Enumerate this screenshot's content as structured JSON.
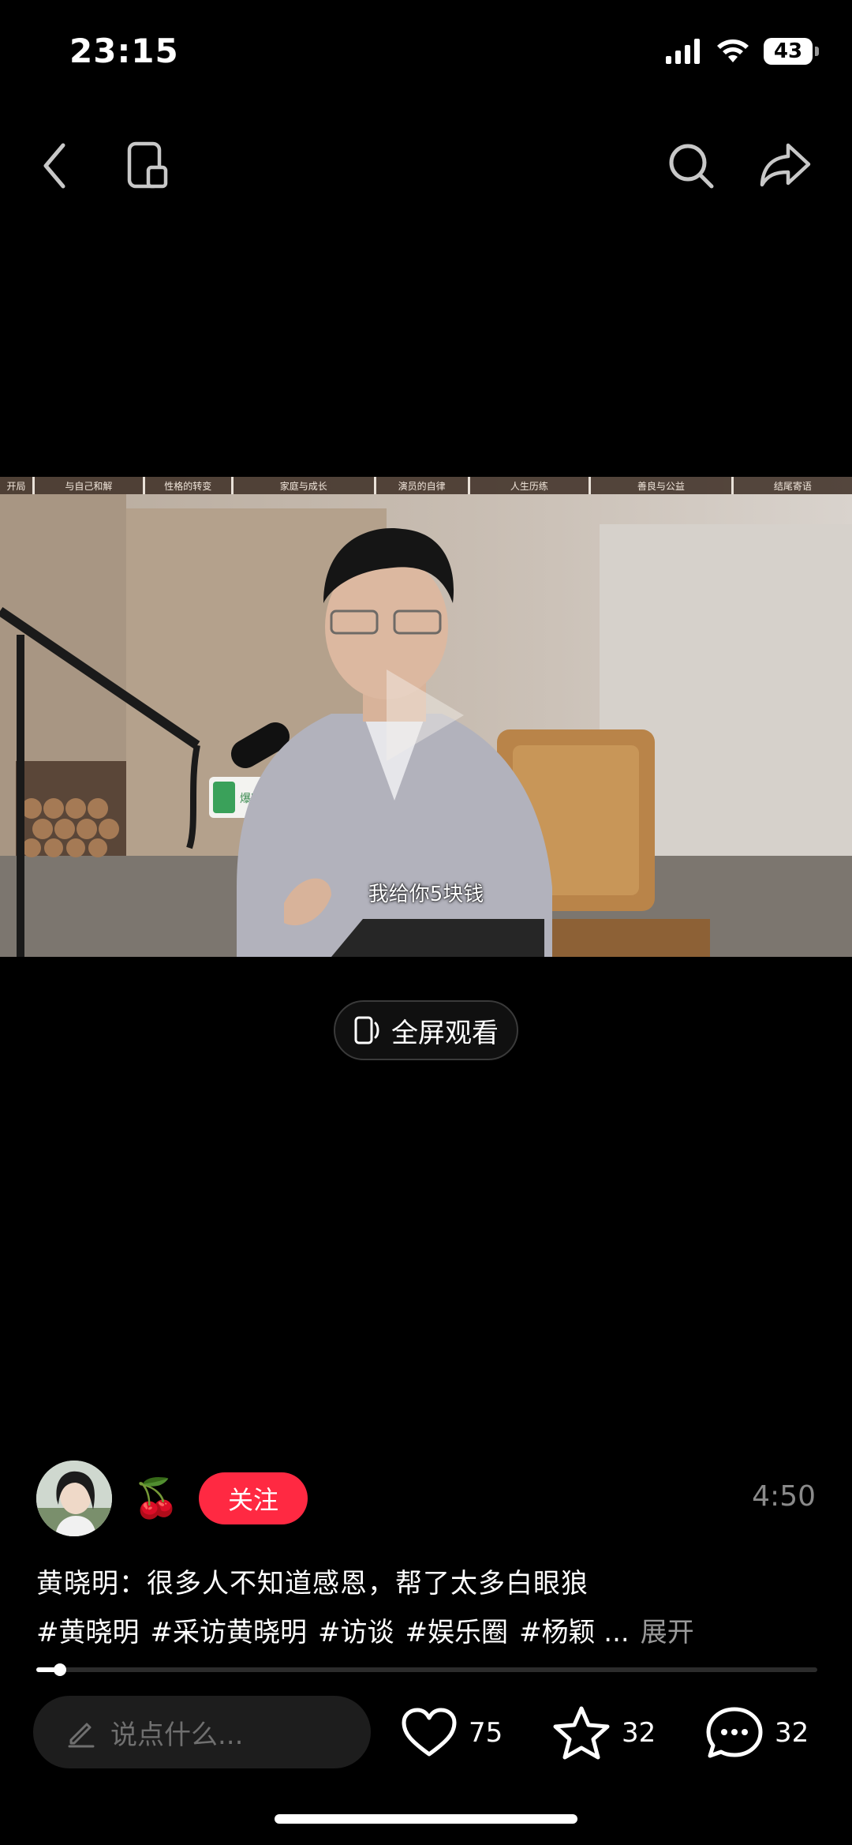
{
  "status": {
    "time": "23:15",
    "battery": "43"
  },
  "video": {
    "chapters": [
      "开局",
      "与自己和解",
      "性格的转变",
      "家庭与成长",
      "演员的自律",
      "人生历练",
      "善良与公益",
      "结尾寄语"
    ],
    "subtitle": "我给你5块钱",
    "mic_logo": "爆吧科技",
    "progress": 0.03
  },
  "fullscreen": {
    "label": "全屏观看"
  },
  "author": {
    "emoji": "🍒",
    "follow_label": "关注"
  },
  "duration": "4:50",
  "post": {
    "title": "黄晓明：很多人不知道感恩，帮了太多白眼狼",
    "tags": [
      "#黄晓明",
      "#采访黄晓明",
      "#访谈",
      "#娱乐圈",
      "#杨颖 ..."
    ],
    "expand_label": "展开"
  },
  "comment_input": {
    "placeholder": "说点什么..."
  },
  "actions": {
    "likes": "75",
    "favorites": "32",
    "comments": "32"
  }
}
